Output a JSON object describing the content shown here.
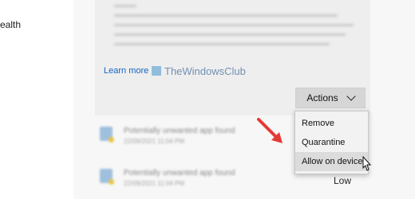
{
  "sidebar": {
    "partial_item_label": "ealth"
  },
  "card": {
    "learn_more": "Learn more",
    "watermark": "TheWindowsClub"
  },
  "actions": {
    "label": "Actions",
    "menu": [
      "Remove",
      "Quarantine",
      "Allow on device"
    ],
    "hovered_item": "Allow on device"
  },
  "history": {
    "rows": [
      {
        "title": "Potentially unwanted app found",
        "date": "22/09/2021 11:04 PM"
      },
      {
        "title": "Potentially unwanted app found",
        "date": "22/09/2021 11:04 PM"
      }
    ],
    "severity_label": "Low"
  },
  "icons": [
    "windowsclub-logo-icon",
    "chevron-down-icon",
    "red-arrow-icon",
    "mouse-pointer-icon",
    "threat-app-icon"
  ],
  "colors": {
    "link": "#1565c0",
    "arrow": "#e53935",
    "button_bg": "#d6d6d6",
    "hover_bg": "#dcdcdc"
  }
}
